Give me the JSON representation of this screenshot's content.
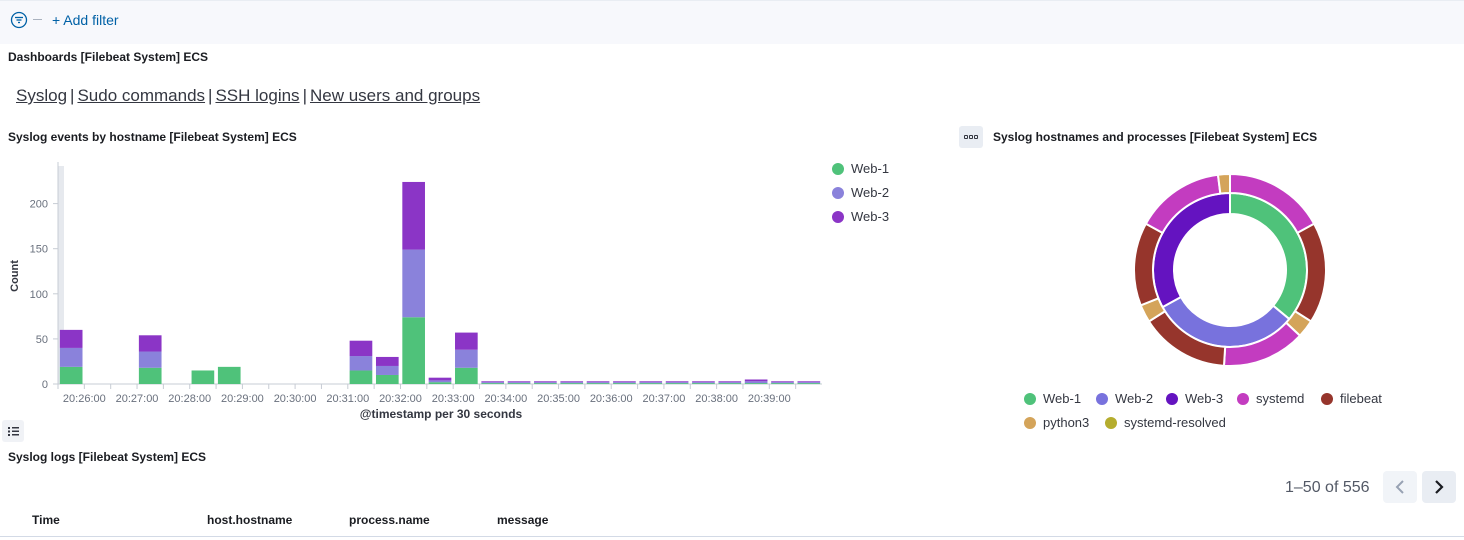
{
  "filter_bar": {
    "add_filter_label": "+ Add filter",
    "filter_icon": "filter-menu-icon"
  },
  "dashboards_panel": {
    "title": "Dashboards [Filebeat System] ECS",
    "links": [
      "Syslog",
      "Sudo commands",
      "SSH logins",
      "New users and groups"
    ],
    "separator": "|"
  },
  "events_panel": {
    "title": "Syslog events by hostname [Filebeat System] ECS"
  },
  "donut_panel": {
    "title": "Syslog hostnames and processes [Filebeat System] ECS",
    "options_icon": "ellipsis-icon"
  },
  "logs_panel": {
    "title": "Syslog logs [Filebeat System] ECS",
    "pagination": "1–50 of 556",
    "columns": [
      "Time",
      "host.hostname",
      "process.name",
      "message"
    ]
  },
  "colors": {
    "web1": "#54b399",
    "web2": "#6092c0",
    "web3": "#9170b8",
    "systemd": "#ca8eae",
    "filebeat": "#aa6556",
    "python3": "#d6bf57",
    "systemd_resolved": "#b9a888"
  },
  "chart_data": [
    {
      "type": "bar",
      "stacked": true,
      "title": "Syslog events by hostname [Filebeat System] ECS",
      "xlabel": "@timestamp per 30 seconds",
      "ylabel": "Count",
      "ylim": [
        0,
        240
      ],
      "yticks": [
        0,
        50,
        100,
        150,
        200
      ],
      "xticks": [
        "20:26:00",
        "20:27:00",
        "20:28:00",
        "20:29:00",
        "20:30:00",
        "20:31:00",
        "20:32:00",
        "20:33:00",
        "20:34:00",
        "20:35:00",
        "20:36:00",
        "20:37:00",
        "20:38:00",
        "20:39:00"
      ],
      "categories": [
        "20:25:30",
        "20:26:00",
        "20:26:30",
        "20:27:00",
        "20:27:30",
        "20:28:00",
        "20:28:30",
        "20:29:00",
        "20:29:30",
        "20:30:00",
        "20:30:30",
        "20:31:00",
        "20:31:30",
        "20:32:00",
        "20:32:30",
        "20:33:00",
        "20:33:30",
        "20:34:00",
        "20:34:30",
        "20:35:00",
        "20:35:30",
        "20:36:00",
        "20:36:30",
        "20:37:00",
        "20:37:30",
        "20:38:00",
        "20:38:30",
        "20:39:00",
        "20:39:30"
      ],
      "series": [
        {
          "name": "Web-1",
          "color": "#4fc27a",
          "values": [
            19,
            0,
            0,
            18,
            0,
            15,
            19,
            0,
            0,
            0,
            0,
            15,
            10,
            74,
            2,
            18,
            1,
            1,
            1,
            1,
            1,
            1,
            1,
            1,
            1,
            1,
            1,
            1,
            1
          ]
        },
        {
          "name": "Web-2",
          "color": "#8a82db",
          "values": [
            21,
            0,
            0,
            18,
            0,
            0,
            0,
            0,
            0,
            0,
            0,
            16,
            10,
            75,
            2,
            20,
            1,
            1,
            1,
            1,
            1,
            1,
            1,
            1,
            1,
            1,
            2,
            1,
            1
          ]
        },
        {
          "name": "Web-3",
          "color": "#8b35c6",
          "values": [
            20,
            0,
            0,
            18,
            0,
            0,
            0,
            0,
            0,
            0,
            0,
            17,
            10,
            75,
            3,
            19,
            1,
            1,
            1,
            1,
            1,
            1,
            1,
            1,
            1,
            1,
            2,
            1,
            1
          ]
        }
      ],
      "legend": "right"
    },
    {
      "type": "pie",
      "donut": true,
      "title": "Syslog hostnames and processes [Filebeat System] ECS",
      "inner_ring": [
        {
          "name": "Web-1",
          "value": 36,
          "color": "#4fc27a"
        },
        {
          "name": "Web-2",
          "value": 31,
          "color": "#7872dd"
        },
        {
          "name": "Web-3",
          "value": 33,
          "color": "#6413c0"
        }
      ],
      "outer_ring": [
        {
          "name": "systemd",
          "value": 17,
          "color": "#c33cc0"
        },
        {
          "name": "filebeat",
          "value": 17,
          "color": "#96352c"
        },
        {
          "name": "python3",
          "value": 3,
          "color": "#d4a45a"
        },
        {
          "name": "systemd",
          "value": 14,
          "color": "#c33cc0"
        },
        {
          "name": "filebeat",
          "value": 15,
          "color": "#96352c"
        },
        {
          "name": "python3",
          "value": 3,
          "color": "#d4a45a"
        },
        {
          "name": "filebeat",
          "value": 14,
          "color": "#96352c"
        },
        {
          "name": "systemd",
          "value": 15,
          "color": "#c33cc0"
        },
        {
          "name": "python3",
          "value": 2,
          "color": "#d4a45a"
        }
      ],
      "legend_items": [
        {
          "name": "Web-1",
          "color": "#4fc27a"
        },
        {
          "name": "Web-2",
          "color": "#7872dd"
        },
        {
          "name": "Web-3",
          "color": "#6413c0"
        },
        {
          "name": "systemd",
          "color": "#c33cc0"
        },
        {
          "name": "filebeat",
          "color": "#96352c"
        },
        {
          "name": "python3",
          "color": "#d4a45a"
        },
        {
          "name": "systemd-resolved",
          "color": "#b5ad2e"
        }
      ],
      "legend": "bottom"
    }
  ]
}
